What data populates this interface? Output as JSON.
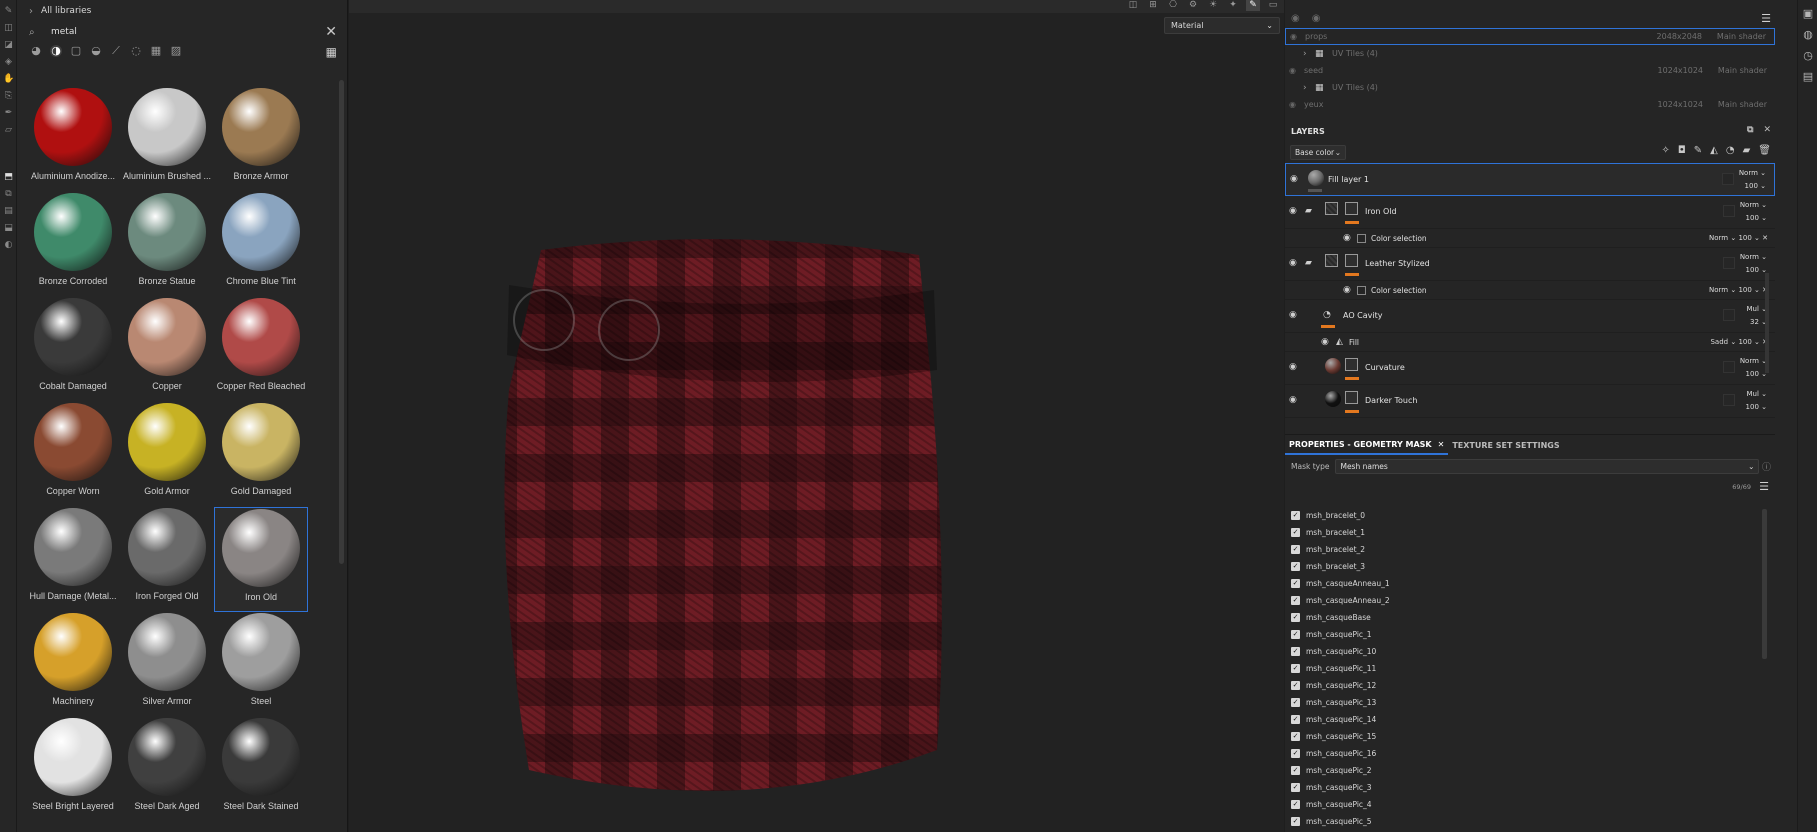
{
  "toolstrip": {
    "tools": [
      "paint-brush",
      "eraser",
      "projection",
      "geometry-mask",
      "smudge",
      "clone",
      "picker",
      "polygon-fill",
      "bake"
    ]
  },
  "assets": {
    "library_label": "All libraries",
    "search_value": "metal",
    "clear_glyph": "✕",
    "materials": [
      {
        "label": "Aluminium Anodize...",
        "color": "#b01010",
        "selected": false
      },
      {
        "label": "Aluminium Brushed ...",
        "color": "#c8c8c8",
        "selected": false
      },
      {
        "label": "Bronze Armor",
        "color": "#9b7a52",
        "selected": false
      },
      {
        "label": "Bronze Corroded",
        "color": "#3f8a6a",
        "selected": false
      },
      {
        "label": "Bronze Statue",
        "color": "#6c8a7e",
        "selected": false
      },
      {
        "label": "Chrome Blue Tint",
        "color": "#8aa4bf",
        "selected": false
      },
      {
        "label": "Cobalt Damaged",
        "color": "#3a3a3a",
        "selected": false
      },
      {
        "label": "Copper",
        "color": "#b98872",
        "selected": false
      },
      {
        "label": "Copper Red Bleached",
        "color": "#b04a48",
        "selected": false
      },
      {
        "label": "Copper Worn",
        "color": "#8a4a32",
        "selected": false
      },
      {
        "label": "Gold Armor",
        "color": "#c7b224",
        "selected": false
      },
      {
        "label": "Gold Damaged",
        "color": "#c9b463",
        "selected": false
      },
      {
        "label": "Hull Damage (Metal...",
        "color": "#7a7a7a",
        "selected": false
      },
      {
        "label": "Iron Forged Old",
        "color": "#6a6a6a",
        "selected": false
      },
      {
        "label": "Iron Old",
        "color": "#8a8584",
        "selected": true
      },
      {
        "label": "Machinery",
        "color": "#d6a02a",
        "selected": false
      },
      {
        "label": "Silver Armor",
        "color": "#8e8e8e",
        "selected": false
      },
      {
        "label": "Steel",
        "color": "#9e9e9e",
        "selected": false
      },
      {
        "label": "Steel Bright Layered",
        "color": "#e2e2e2",
        "selected": false
      },
      {
        "label": "Steel Dark Aged",
        "color": "#404040",
        "selected": false
      },
      {
        "label": "Steel Dark Stained",
        "color": "#3a3a3a",
        "selected": false
      }
    ]
  },
  "viewport": {
    "material_dropdown": "Material",
    "cloth_color": "#6e1c24",
    "cloth_dark": "#2a0c10"
  },
  "texture_sets": [
    {
      "name": "props",
      "resolution": "2048x2048",
      "shader": "Main shader",
      "selected": true,
      "uv_tiles": "UV Tiles (4)"
    },
    {
      "name": "seed",
      "resolution": "1024x1024",
      "shader": "Main shader",
      "selected": false,
      "uv_tiles": "UV Tiles (4)"
    },
    {
      "name": "yeux",
      "resolution": "1024x1024",
      "shader": "Main shader",
      "selected": false
    }
  ],
  "layers": {
    "title": "LAYERS",
    "channel": "Base color",
    "items": [
      {
        "type": "layer",
        "name": "Fill layer 1",
        "blend": "Norm",
        "opacity": "100",
        "thumb": "#6a6a6a",
        "selected": true
      },
      {
        "type": "folder",
        "name": "Iron Old",
        "blend": "Norm",
        "opacity": "100"
      },
      {
        "type": "sub",
        "name": "Color selection",
        "blend": "Norm",
        "opacity": "100"
      },
      {
        "type": "folder",
        "name": "Leather Stylized",
        "blend": "Norm",
        "opacity": "100"
      },
      {
        "type": "sub",
        "name": "Color selection",
        "blend": "Norm",
        "opacity": "100"
      },
      {
        "type": "gen",
        "name": "AO Cavity",
        "blend": "Mul",
        "opacity": "32"
      },
      {
        "type": "fill",
        "name": "Fill",
        "blend": "Sadd",
        "opacity": "100"
      },
      {
        "type": "layer",
        "name": "Curvature",
        "blend": "Norm",
        "opacity": "100",
        "thumb": "#6b3a32"
      },
      {
        "type": "layer",
        "name": "Darker Touch",
        "blend": "Mul",
        "opacity": "100",
        "thumb": "#111111"
      }
    ]
  },
  "properties": {
    "tab_active": "PROPERTIES - GEOMETRY MASK",
    "tab_other": "TEXTURE SET SETTINGS",
    "mask_type_label": "Mask type",
    "mask_type_value": "Mesh names",
    "count": "69/69",
    "meshes": [
      "msh_bracelet_0",
      "msh_bracelet_1",
      "msh_bracelet_2",
      "msh_bracelet_3",
      "msh_casqueAnneau_1",
      "msh_casqueAnneau_2",
      "msh_casqueBase",
      "msh_casquePic_1",
      "msh_casquePic_10",
      "msh_casquePic_11",
      "msh_casquePic_12",
      "msh_casquePic_13",
      "msh_casquePic_14",
      "msh_casquePic_15",
      "msh_casquePic_16",
      "msh_casquePic_2",
      "msh_casquePic_3",
      "msh_casquePic_4",
      "msh_casquePic_5"
    ]
  },
  "accent_color": "#2f73d8",
  "mask_bar_color": "#e3781f"
}
